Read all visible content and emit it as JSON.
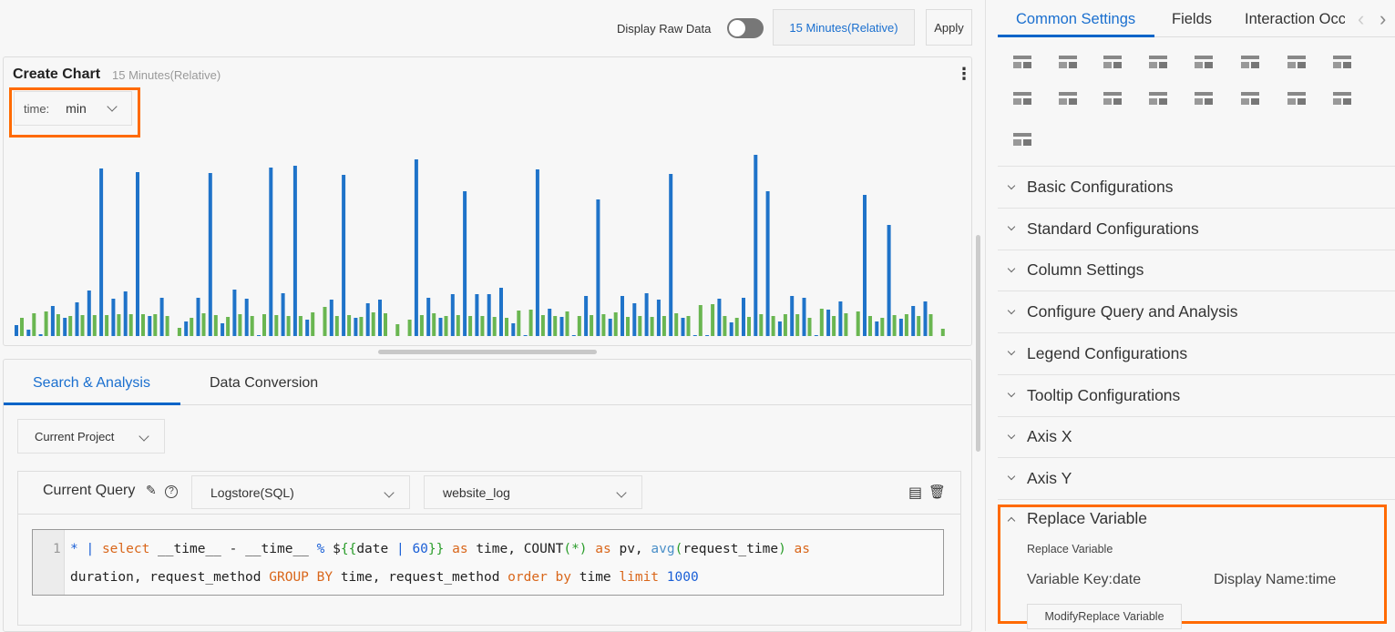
{
  "toolbar": {
    "raw_data_label": "Display Raw Data",
    "raw_data_on": false,
    "time_range": "15 Minutes(Relative)",
    "apply": "Apply"
  },
  "chart_panel": {
    "title": "Create Chart",
    "subtitle": "15 Minutes(Relative)",
    "variable_label": "time:",
    "variable_value": "min"
  },
  "chart_data": {
    "type": "bar",
    "grid": false,
    "colors": [
      "#1f73c9",
      "#6ab651"
    ],
    "series": [
      {
        "values": [
          12,
          7,
          2,
          33,
          20,
          37,
          50,
          184,
          41,
          49,
          180,
          22,
          42,
          0,
          16,
          42,
          179,
          14,
          51,
          41,
          1,
          185,
          47,
          187,
          18,
          0,
          40,
          177,
          20,
          36,
          40,
          0,
          0,
          194,
          42,
          20,
          46,
          159,
          46,
          46,
          53,
          14,
          1,
          183,
          30,
          21,
          1,
          44,
          150,
          19,
          44,
          36,
          47,
          40,
          178,
          20,
          1,
          1,
          41,
          15,
          42,
          199,
          159,
          16,
          44,
          42,
          1,
          29,
          38,
          0,
          155,
          16,
          122,
          19,
          33,
          38,
          0
        ]
      },
      {
        "values": [
          20,
          25,
          27,
          24,
          22,
          23,
          23,
          23,
          24,
          24,
          24,
          24,
          22,
          9,
          20,
          25,
          23,
          21,
          24,
          22,
          24,
          23,
          22,
          22,
          26,
          32,
          22,
          23,
          21,
          26,
          25,
          13,
          18,
          23,
          25,
          22,
          23,
          22,
          22,
          21,
          20,
          28,
          29,
          23,
          22,
          27,
          22,
          23,
          24,
          26,
          21,
          22,
          21,
          22,
          25,
          22,
          34,
          35,
          22,
          20,
          21,
          24,
          22,
          24,
          24,
          20,
          30,
          22,
          25,
          27,
          22,
          20,
          23,
          24,
          22,
          24,
          8
        ]
      }
    ]
  },
  "tabs": {
    "items": [
      {
        "label": "Search & Analysis",
        "active": true
      },
      {
        "label": "Data Conversion",
        "active": false
      }
    ]
  },
  "query": {
    "project": "Current Project",
    "label": "Current Query",
    "store_type": "Logstore(SQL)",
    "logstore": "website_log",
    "line_number": "1",
    "line1": [
      [
        "* ",
        "t-blue"
      ],
      [
        "| ",
        "t-blue"
      ],
      [
        "select ",
        "t-kw"
      ],
      [
        "__time__ - __time__ ",
        "t-plain"
      ],
      [
        "% ",
        "t-blue"
      ],
      [
        "$",
        "t-plain"
      ],
      [
        "{{",
        "t-green"
      ],
      [
        "date ",
        "t-plain"
      ],
      [
        "| ",
        "t-blue"
      ],
      [
        "60",
        "t-blue"
      ],
      [
        "}}",
        "t-green"
      ],
      [
        " as ",
        "t-kw"
      ],
      [
        "time, COUNT",
        "t-plain"
      ],
      [
        "(*)",
        "t-green"
      ],
      [
        " as ",
        "t-kw"
      ],
      [
        "pv, ",
        "t-plain"
      ],
      [
        "avg",
        "t-lb"
      ],
      [
        "(",
        "t-green"
      ],
      [
        "request_time",
        "t-plain"
      ],
      [
        ")",
        "t-green"
      ],
      [
        " as",
        "t-kw"
      ]
    ],
    "line2": [
      [
        "duration, request_method ",
        "t-plain"
      ],
      [
        "GROUP BY ",
        "t-kw"
      ],
      [
        "time, request_method ",
        "t-plain"
      ],
      [
        "order by ",
        "t-kw"
      ],
      [
        "time ",
        "t-plain"
      ],
      [
        "limit ",
        "t-kw"
      ],
      [
        "1000",
        "t-blue"
      ]
    ]
  },
  "right": {
    "tabs": [
      {
        "label": "Common Settings",
        "active": true
      },
      {
        "label": "Fields",
        "active": false
      },
      {
        "label": "Interaction Occ",
        "active": false
      }
    ],
    "chart_icons": [
      "number-chart-icon",
      "progress-bar-icon",
      "flow-chart-icon",
      "map-icon",
      "amap-icon",
      "sankey-icon",
      "word-cloud-icon",
      "treemap-icon",
      "funnel-icon",
      "column-chart-icon",
      "histogram-icon",
      "table-icon",
      "tree-icon",
      "china-map-icon",
      "location-map-icon",
      "scatter-chart-icon",
      "boxplot-icon"
    ],
    "sections": [
      "Basic Configurations",
      "Standard Configurations",
      "Column Settings",
      "Configure Query and Analysis",
      "Legend Configurations",
      "Tooltip Configurations",
      "Axis X",
      "Axis Y"
    ],
    "replace": {
      "title": "Replace Variable",
      "subtitle": "Replace Variable",
      "key": "Variable Key:date",
      "display": "Display Name:time",
      "button": "ModifyReplace Variable"
    },
    "highlight_color": "#ff6a00"
  }
}
